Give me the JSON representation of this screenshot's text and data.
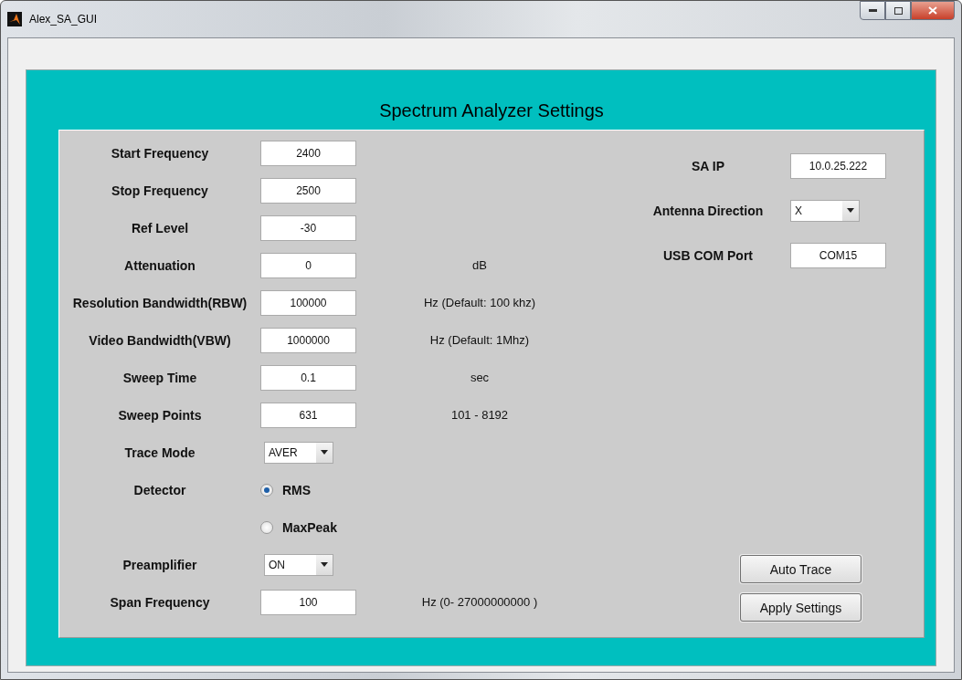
{
  "window": {
    "title": "Alex_SA_GUI"
  },
  "panel": {
    "title": "Spectrum Analyzer Settings"
  },
  "left_rows": [
    {
      "kind": "field",
      "label": "Start Frequency",
      "value": "2400"
    },
    {
      "kind": "field",
      "label": "Stop Frequency",
      "value": "2500"
    },
    {
      "kind": "field",
      "label": "Ref Level",
      "value": "-30"
    },
    {
      "kind": "field",
      "label": "Attenuation",
      "value": "0",
      "unit": "dB"
    },
    {
      "kind": "field",
      "label": "Resolution Bandwidth(RBW)",
      "value": "100000",
      "unit": "Hz (Default: 100 khz)"
    },
    {
      "kind": "field",
      "label": "Video Bandwidth(VBW)",
      "value": "1000000",
      "unit": "Hz (Default: 1Mhz)"
    },
    {
      "kind": "field",
      "label": "Sweep Time",
      "value": "0.1",
      "unit": "sec"
    },
    {
      "kind": "field",
      "label": "Sweep Points",
      "value": "631",
      "unit": "101 - 8192"
    },
    {
      "kind": "dropdown",
      "label": "Trace Mode",
      "value": "AVER"
    },
    {
      "kind": "radio",
      "label": "Detector",
      "option": "RMS",
      "selected": true
    },
    {
      "kind": "radio",
      "option": "MaxPeak",
      "selected": false
    },
    {
      "kind": "dropdown",
      "label": "Preamplifier",
      "value": "ON"
    },
    {
      "kind": "field",
      "label": "Span Frequency",
      "value": "100",
      "unit": "Hz (0- 27000000000 )"
    }
  ],
  "right_rows": [
    {
      "kind": "field",
      "label": "SA IP",
      "value": "10.0.25.222"
    },
    {
      "kind": "dropdown",
      "label": "Antenna Direction",
      "value": "X"
    },
    {
      "kind": "field",
      "label": "USB COM Port",
      "value": "COM15"
    }
  ],
  "buttons": [
    "Auto Trace",
    "Apply Settings"
  ]
}
